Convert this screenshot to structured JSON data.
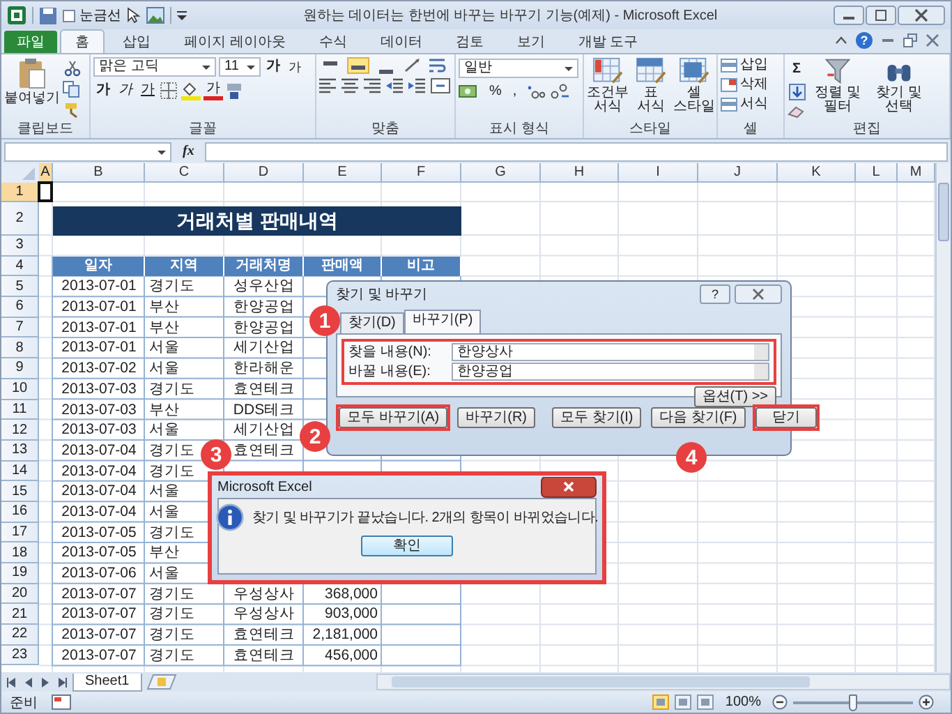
{
  "window": {
    "title": "원하는 데이터는 한번에 바꾸는 바꾸기 기능(예제) - Microsoft Excel"
  },
  "quick_access": {
    "gridlines_label": "눈금선",
    "checked": false
  },
  "ribbon_tabs": [
    {
      "label": "파일",
      "kind": "file",
      "selected": false
    },
    {
      "label": "홈",
      "kind": "tab",
      "selected": true
    },
    {
      "label": "삽입",
      "kind": "tab",
      "selected": false
    },
    {
      "label": "페이지 레이아웃",
      "kind": "tab",
      "selected": false
    },
    {
      "label": "수식",
      "kind": "tab",
      "selected": false
    },
    {
      "label": "데이터",
      "kind": "tab",
      "selected": false
    },
    {
      "label": "검토",
      "kind": "tab",
      "selected": false
    },
    {
      "label": "보기",
      "kind": "tab",
      "selected": false
    },
    {
      "label": "개발 도구",
      "kind": "tab",
      "selected": false
    }
  ],
  "help": "?",
  "clipboard": {
    "paste": "붙여넣기",
    "label": "클립보드"
  },
  "font": {
    "name": "맑은 고딕",
    "size": "11",
    "grow": "가",
    "shrink": "가",
    "bold": "가",
    "italic": "가",
    "underline": "가",
    "text_color": "가",
    "label": "글꼴"
  },
  "alignment": {
    "vertical": [
      {
        "selected": false
      },
      {
        "selected": true
      },
      {
        "selected": false
      }
    ],
    "label": "맞춤"
  },
  "number": {
    "format": "일반",
    "percent": "%",
    "comma": ",",
    "label": "표시 형식"
  },
  "styles": {
    "buttons": [
      "조건부 서식",
      "표 서식",
      "셀 스타일"
    ],
    "label": "스타일"
  },
  "cells": {
    "buttons": [
      "삽입",
      "삭제",
      "서식"
    ],
    "label": "셀"
  },
  "editing": {
    "sum": "Σ",
    "buttons": [
      "정렬 및 필터",
      "찾기 및 선택"
    ],
    "label": "편집"
  },
  "formula_bar": {
    "fx": "fx"
  },
  "sheet": {
    "columns": [
      {
        "label": "A",
        "selected": true
      },
      {
        "label": "B",
        "selected": false
      },
      {
        "label": "C",
        "selected": false
      },
      {
        "label": "D",
        "selected": false
      },
      {
        "label": "E",
        "selected": false
      },
      {
        "label": "F",
        "selected": false
      },
      {
        "label": "G",
        "selected": false
      },
      {
        "label": "H",
        "selected": false
      },
      {
        "label": "I",
        "selected": false
      },
      {
        "label": "J",
        "selected": false
      },
      {
        "label": "K",
        "selected": false
      },
      {
        "label": "L",
        "selected": false
      },
      {
        "label": "M",
        "selected": false
      }
    ],
    "rows": [
      {
        "label": "1",
        "selected": true
      },
      {
        "label": "2",
        "selected": false
      },
      {
        "label": "3",
        "selected": false
      },
      {
        "label": "4",
        "selected": false
      },
      {
        "label": "5",
        "selected": false
      },
      {
        "label": "6",
        "selected": false
      },
      {
        "label": "7",
        "selected": false
      },
      {
        "label": "8",
        "selected": false
      },
      {
        "label": "9",
        "selected": false
      },
      {
        "label": "10",
        "selected": false
      },
      {
        "label": "11",
        "selected": false
      },
      {
        "label": "12",
        "selected": false
      },
      {
        "label": "13",
        "selected": false
      },
      {
        "label": "14",
        "selected": false
      },
      {
        "label": "15",
        "selected": false
      },
      {
        "label": "16",
        "selected": false
      },
      {
        "label": "17",
        "selected": false
      },
      {
        "label": "18",
        "selected": false
      },
      {
        "label": "19",
        "selected": false
      },
      {
        "label": "20",
        "selected": false
      },
      {
        "label": "21",
        "selected": false
      },
      {
        "label": "22",
        "selected": false
      },
      {
        "label": "23",
        "selected": false
      }
    ],
    "title": "거래처별 판매내역",
    "headers": [
      "일자",
      "지역",
      "거래처명",
      "판매액",
      "비고"
    ],
    "records": [
      {
        "date": "2013-07-01",
        "region": "경기도",
        "client": "성우산업"
      },
      {
        "date": "2013-07-01",
        "region": "부산",
        "client": "한양공업"
      },
      {
        "date": "2013-07-01",
        "region": "부산",
        "client": "한양공업"
      },
      {
        "date": "2013-07-01",
        "region": "서울",
        "client": "세기산업"
      },
      {
        "date": "2013-07-02",
        "region": "서울",
        "client": "한라해운"
      },
      {
        "date": "2013-07-03",
        "region": "경기도",
        "client": "효연테크"
      },
      {
        "date": "2013-07-03",
        "region": "부산",
        "client": "DDS테크"
      },
      {
        "date": "2013-07-03",
        "region": "서울",
        "client": "세기산업"
      },
      {
        "date": "2013-07-04",
        "region": "경기도",
        "client": "효연테크"
      },
      {
        "date": "2013-07-04",
        "region": "경기도"
      },
      {
        "date": "2013-07-04",
        "region": "서울"
      },
      {
        "date": "2013-07-04",
        "region": "서울"
      },
      {
        "date": "2013-07-05",
        "region": "경기도"
      },
      {
        "date": "2013-07-05",
        "region": "부산"
      },
      {
        "date": "2013-07-06",
        "region": "서울"
      },
      {
        "date": "2013-07-07",
        "region": "경기도",
        "client": "우성상사",
        "amount": "368,000"
      },
      {
        "date": "2013-07-07",
        "region": "경기도",
        "client": "우성상사",
        "amount": "903,000"
      },
      {
        "date": "2013-07-07",
        "region": "경기도",
        "client": "효연테크",
        "amount": "2,181,000"
      },
      {
        "date": "2013-07-07",
        "region": "경기도",
        "client": "효연테크",
        "amount": "456,000"
      }
    ]
  },
  "find_dialog": {
    "title": "찾기 및 바꾸기",
    "help": "?",
    "tabs": [
      {
        "label": "찾기(D)",
        "selected": false
      },
      {
        "label": "바꾸기(P)",
        "selected": true
      }
    ],
    "fields": [
      {
        "label": "찾을 내용(N):",
        "value": "한양상사"
      },
      {
        "label": "바꿀 내용(E):",
        "value": "한양공업"
      }
    ],
    "options": "옵션(T) >>",
    "buttons": [
      {
        "label": "모두 바꾸기(A)",
        "highlighted": true
      },
      {
        "label": "바꾸기(R)",
        "highlighted": false
      },
      {
        "label": "모두 찾기(I)",
        "highlighted": false
      },
      {
        "label": "다음 찾기(F)",
        "highlighted": false
      },
      {
        "label": "닫기",
        "highlighted": true
      }
    ]
  },
  "message_box": {
    "title": "Microsoft Excel",
    "text": "찾기 및 바꾸기가 끝났습니다. 2개의 항목이 바뀌었습니다.",
    "button": "확인"
  },
  "callouts": [
    "1",
    "2",
    "3",
    "4"
  ],
  "sheet_tabs": [
    {
      "label": "Sheet1",
      "selected": true
    }
  ],
  "status_bar": {
    "status": "준비",
    "views": [
      {
        "selected": true
      },
      {
        "selected": false
      },
      {
        "selected": false
      }
    ],
    "zoom": "100%",
    "zoom_slider": {
      "level": 0.5
    }
  }
}
